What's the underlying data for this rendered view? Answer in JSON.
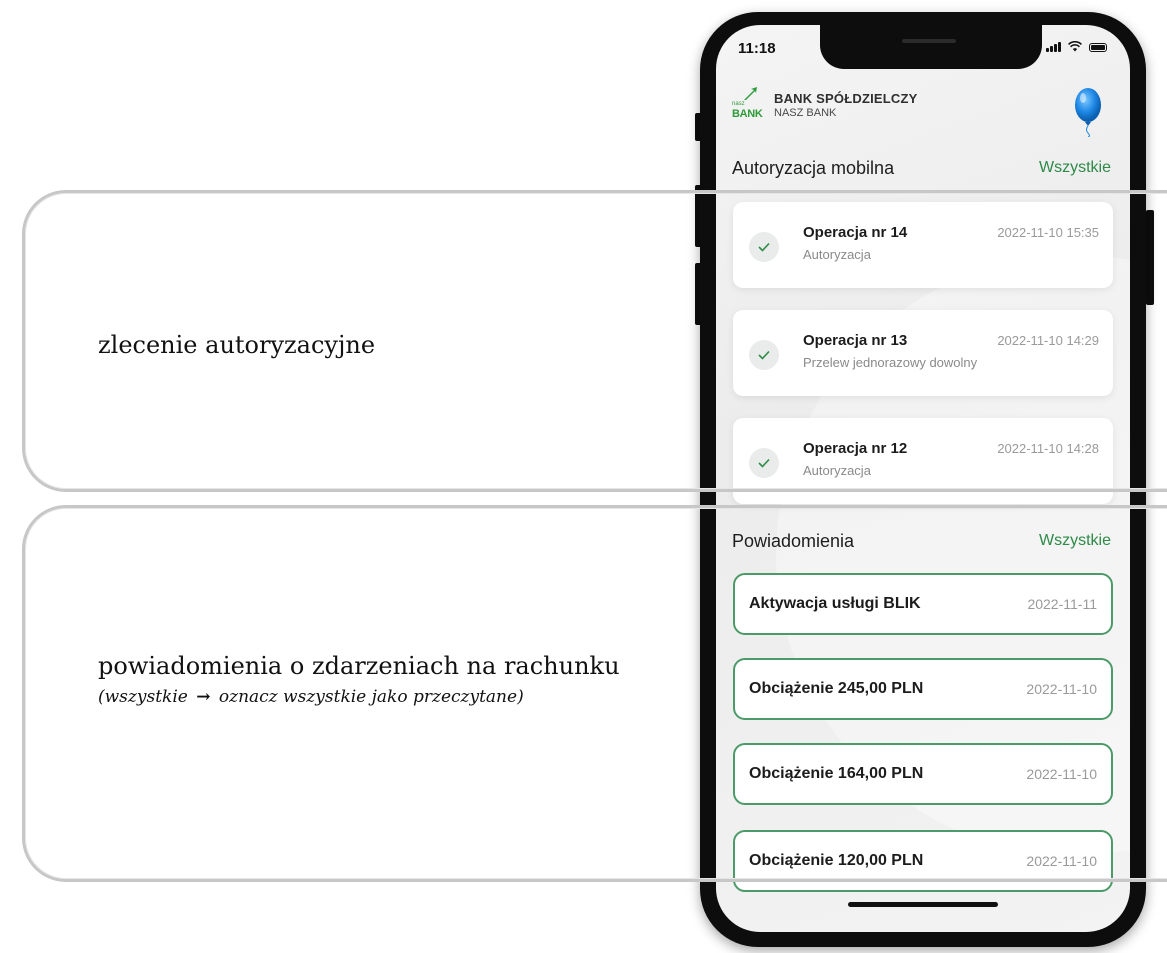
{
  "callouts": {
    "authorization_label": "zlecenie autoryzacyjne",
    "notifications_label": "powiadomienia o zdarzeniach na rachunku",
    "notifications_sub_before": "(wszystkie",
    "notifications_sub_arrow": "→",
    "notifications_sub_after": "oznacz wszystkie jako przeczytane)"
  },
  "status_bar": {
    "time": "11:18",
    "icons": [
      "signal-icon",
      "wifi-icon",
      "battery-icon"
    ]
  },
  "header": {
    "logo_small": "nasz",
    "logo_main": "BANK",
    "bank_name": "BANK SPÓŁDZIELCZY",
    "bank_subname": "NASZ BANK",
    "right_icon": "balloon-icon"
  },
  "authorization": {
    "title": "Autoryzacja mobilna",
    "link": "Wszystkie",
    "items": [
      {
        "title": "Operacja nr 14",
        "subtitle": "Autoryzacja",
        "date": "2022-11-10 15:35"
      },
      {
        "title": "Operacja nr 13",
        "subtitle": "Przelew jednorazowy dowolny",
        "date": "2022-11-10 14:29"
      },
      {
        "title": "Operacja nr 12",
        "subtitle": "Autoryzacja",
        "date": "2022-11-10 14:28"
      }
    ]
  },
  "notifications": {
    "title": "Powiadomienia",
    "link": "Wszystkie",
    "items": [
      {
        "title": "Aktywacja usługi BLIK",
        "date": "2022-11-11"
      },
      {
        "title": "Obciążenie 245,00 PLN",
        "date": "2022-11-10"
      },
      {
        "title": "Obciążenie 164,00 PLN",
        "date": "2022-11-10"
      },
      {
        "title": "Obciążenie 120,00 PLN",
        "date": "2022-11-10"
      }
    ]
  },
  "colors": {
    "accent_green": "#2e8a48",
    "card_border_green": "#4c9a69",
    "logo_green": "#2d9b3a",
    "balloon_blue": "#1e88e5"
  }
}
